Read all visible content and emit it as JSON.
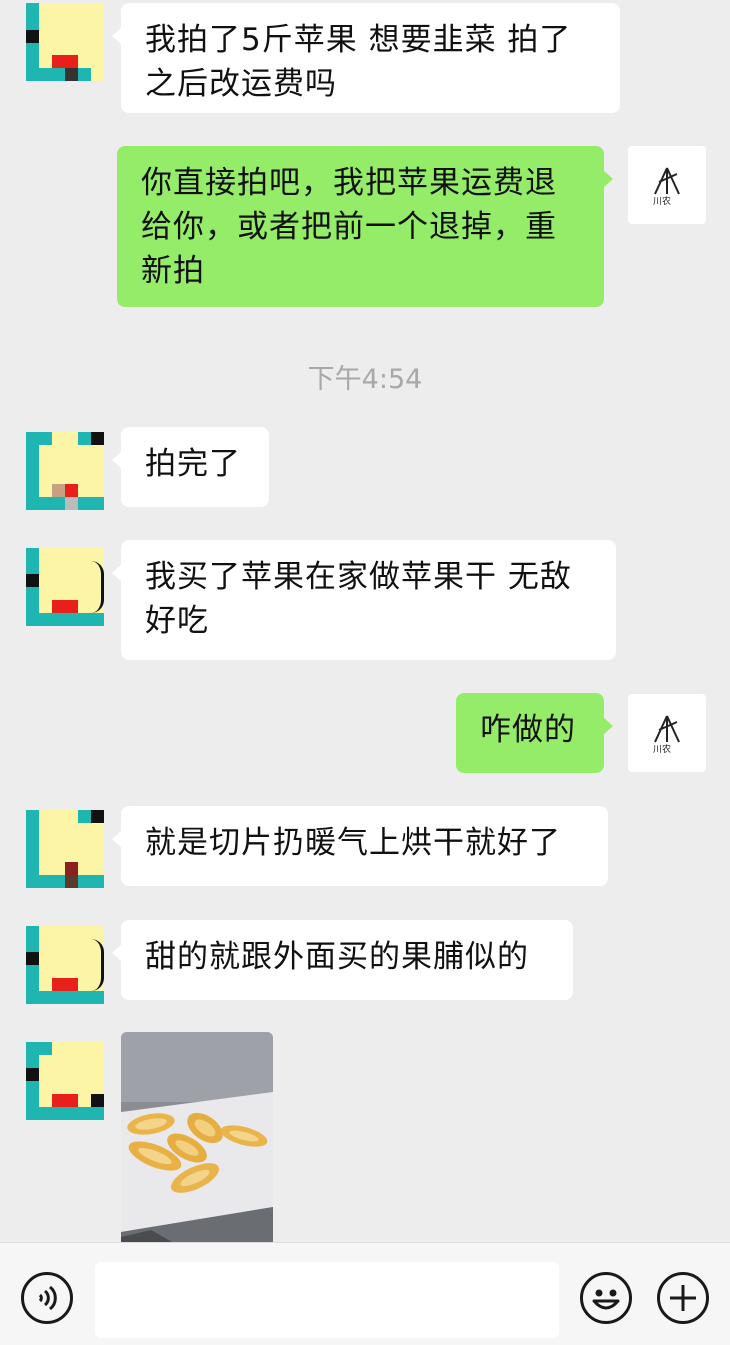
{
  "chat": {
    "messages": [
      {
        "text_lines": [
          "我拍了5斤苹果  想要韭菜  拍了",
          "之后改运费吗"
        ]
      },
      {
        "text_lines": [
          "你直接拍吧，我把苹果运费退",
          "给你，或者把前一个退掉，重",
          "新拍"
        ]
      },
      {
        "text_lines": [
          "拍完了"
        ]
      },
      {
        "text_lines": [
          "我买了苹果在家做苹果干  无敌",
          "好吃"
        ]
      },
      {
        "text_lines": [
          "咋做的"
        ]
      },
      {
        "text_lines": [
          "就是切片扔暖气上烘干就好了"
        ]
      },
      {
        "text_lines": [
          "甜的就跟外面买的果脯似的"
        ]
      }
    ],
    "timestamp": "下午4:54"
  },
  "input_bar": {
    "voice_icon": "voice-icon",
    "emoji_icon": "emoji-icon",
    "plus_icon": "plus-icon",
    "input_value": ""
  },
  "colors": {
    "outgoing_bubble": "#95ec69",
    "incoming_bubble": "#ffffff",
    "background": "#ededed"
  }
}
